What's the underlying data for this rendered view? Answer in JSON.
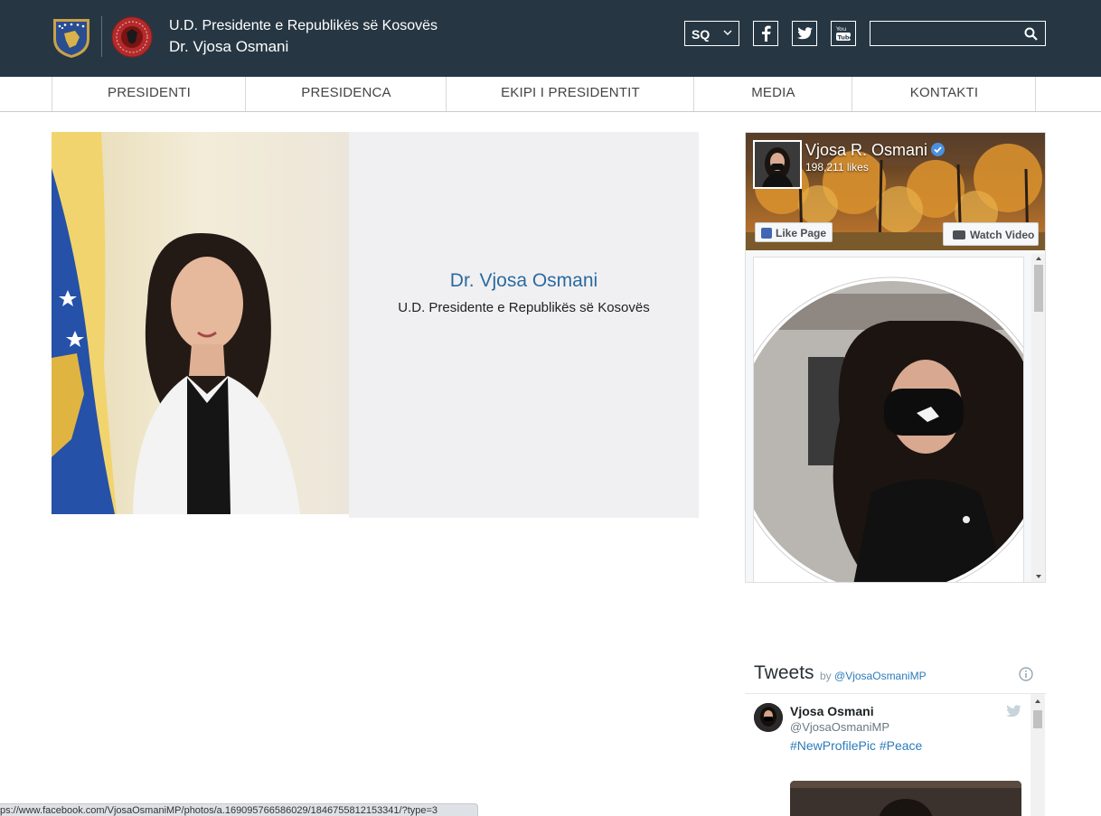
{
  "header": {
    "title_line1": "U.D. Presidente e Republikës së Kosovës",
    "title_line2": "Dr. Vjosa Osmani",
    "language": "SQ",
    "social": [
      "facebook-icon",
      "twitter-icon",
      "youtube-icon"
    ],
    "search": {
      "value": "",
      "placeholder": ""
    },
    "bg_color": "#263743"
  },
  "nav": {
    "items": [
      {
        "label": "PRESIDENTI"
      },
      {
        "label": "PRESIDENCA"
      },
      {
        "label": "EKIPI I PRESIDENTIT"
      },
      {
        "label": "MEDIA"
      },
      {
        "label": "KONTAKTI"
      }
    ]
  },
  "hero": {
    "name": "Dr. Vjosa Osmani",
    "title": "U.D. Presidente e Republikës së Kosovës",
    "name_color": "#2c6aa0"
  },
  "facebook": {
    "page_name": "Vjosa R. Osmani",
    "likes": "198,211 likes",
    "like_button": "Like Page",
    "watch_button": "Watch Video"
  },
  "twitter": {
    "title": "Tweets",
    "by": "by",
    "handle_link": "@VjosaOsmaniMP",
    "tweet": {
      "name": "Vjosa Osmani",
      "handle": "@VjosaOsmaniMP",
      "text": "#NewProfilePic #Peace"
    }
  },
  "status_bar": {
    "url": "ps://www.facebook.com/VjosaOsmaniMP/photos/a.169095766586029/1846755812153341/?type=3"
  }
}
